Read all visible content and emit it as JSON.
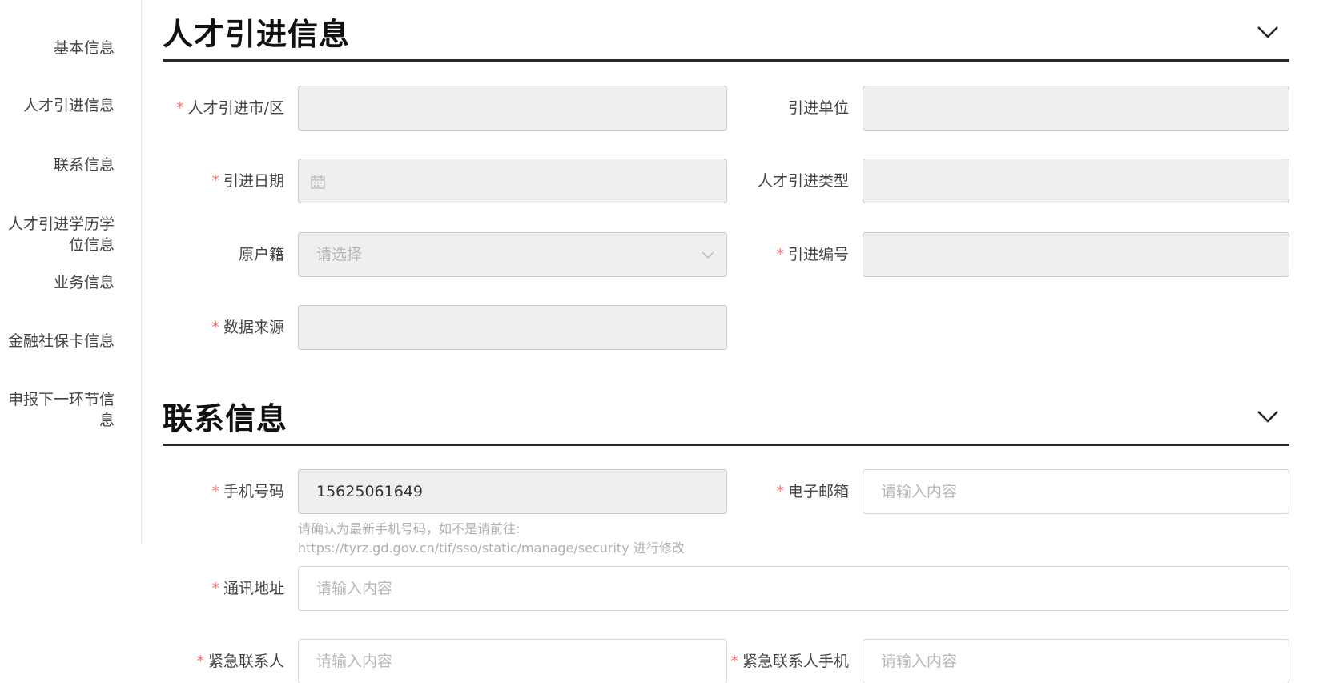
{
  "sidebar": {
    "items": [
      {
        "label": "基本信息"
      },
      {
        "label": "人才引进信息"
      },
      {
        "label": "联系信息"
      },
      {
        "label_line1": "人才引进学历学",
        "label_line2": "位信息"
      },
      {
        "label": "业务信息"
      },
      {
        "label": "金融社保卡信息"
      },
      {
        "label_line1": "申报下一环节信",
        "label_line2": "息"
      }
    ]
  },
  "sections": {
    "talent": {
      "title": "人才引进信息",
      "fields": {
        "city": {
          "label": "人才引进市/区",
          "required": "*",
          "value": ""
        },
        "unit": {
          "label": "引进单位",
          "value": ""
        },
        "date": {
          "label": "引进日期",
          "required": "*",
          "value": ""
        },
        "type": {
          "label": "人才引进类型",
          "value": ""
        },
        "hukou": {
          "label": "原户籍",
          "placeholder": "请选择"
        },
        "number": {
          "label": "引进编号",
          "required": "*",
          "value": ""
        },
        "source": {
          "label": "数据来源",
          "required": "*",
          "value": ""
        }
      }
    },
    "contact": {
      "title": "联系信息",
      "fields": {
        "phone": {
          "label": "手机号码",
          "required": "*",
          "value": "15625061649",
          "hint_line1": "请确认为最新手机号码，如不是请前往:",
          "hint_line2": "https://tyrz.gd.gov.cn/tif/sso/static/manage/security 进行修改"
        },
        "email": {
          "label": "电子邮箱",
          "required": "*",
          "placeholder": "请输入内容"
        },
        "address": {
          "label": "通讯地址",
          "required": "*",
          "placeholder": "请输入内容"
        },
        "emergency_name": {
          "label": "紧急联系人",
          "required": "*",
          "placeholder": "请输入内容"
        },
        "emergency_phone": {
          "label": "紧急联系人手机",
          "required": "*",
          "placeholder": "请输入内容"
        }
      }
    }
  },
  "colors": {
    "required": "#f56c6c",
    "rule": "#2b2b2b",
    "disabled_bg": "#efefef",
    "placeholder": "#b8b8b8"
  },
  "icons": {
    "collapse": "chevron-down-icon",
    "date": "calendar-icon",
    "select": "chevron-down-icon"
  }
}
